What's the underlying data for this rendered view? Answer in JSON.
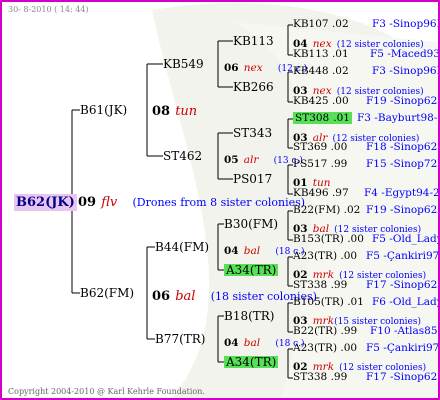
{
  "header": "30-  8-2010 ( 14: 44)",
  "footer": "Copyright 2004-2010 @ Karl Kehrle Foundation.",
  "root": {
    "name": "B62(JK)",
    "gen": "09",
    "queen": "flv",
    "note": "(Drones from 8 sister colonies)"
  },
  "l1": [
    {
      "name": "B61(JK)",
      "gen": "08",
      "queen": "tun"
    },
    {
      "name": "B62(FM)",
      "gen": "06",
      "queen": "bal",
      "note": "(18 sister colonies)"
    }
  ],
  "l2": [
    {
      "name": "KB549",
      "gen": "06",
      "queen": "nex",
      "note": "(12 c.)"
    },
    {
      "name": "ST462",
      "gen": "05",
      "queen": "alr",
      "note": "(13 c.)"
    },
    {
      "name": "B44(FM)",
      "gen": "04",
      "queen": "bal",
      "note": "(18 c.)"
    },
    {
      "name": "B77(TR)",
      "gen": "04",
      "queen": "bal",
      "note": "(18 c.)"
    }
  ],
  "l3": [
    "KB113",
    "KB266",
    "ST343",
    "PS017",
    "B30(FM)",
    "A34(TR)",
    "B18(TR)",
    "A34(TR)"
  ],
  "l4": [
    {
      "name": "KB107",
      "val": ".02",
      "ref": "F3 -Sinop96R"
    },
    {
      "gen": "04",
      "queen": "nex",
      "note": "(12 sister colonies)"
    },
    {
      "name": "KB113",
      "val": ".01",
      "ref": "F5 -Maced93R"
    },
    {
      "name": "KB448",
      "val": ".02",
      "ref": "F3 -Sinop96R"
    },
    {
      "gen": "03",
      "queen": "nex",
      "note": "(12 sister colonies)"
    },
    {
      "name": "KB425",
      "val": ".00",
      "ref": "F19 -Sinop62R"
    },
    {
      "name": "ST308",
      "val": ".01",
      "ref": "F3 -Bayburt98-3R"
    },
    {
      "gen": "03",
      "queen": "alr",
      "note": "(12 sister colonies)"
    },
    {
      "name": "ST369",
      "val": ".00",
      "ref": "F18 -Sinop62R"
    },
    {
      "name": "PS517",
      "val": ".99",
      "ref": "F15 -Sinop72R"
    },
    {
      "gen": "01",
      "queen": "tun"
    },
    {
      "name": "KB496",
      "val": ".97",
      "ref": "F4 -Egypt94-2R"
    },
    {
      "name": "B22(FM)",
      "val": ".02",
      "ref": "F19 -Sinop62R"
    },
    {
      "gen": "03",
      "queen": "bal",
      "note": "(12 sister colonies)"
    },
    {
      "name": "B153(TR)",
      "val": ".00",
      "ref": "F5 -Old_Lady"
    },
    {
      "name": "A23(TR)",
      "val": ".00",
      "ref": "F5 -Çankiri97R"
    },
    {
      "gen": "02",
      "queen": "mrk",
      "note": "(12 sister colonies)"
    },
    {
      "name": "ST338",
      "val": ".99",
      "ref": "F17 -Sinop62R"
    },
    {
      "name": "B105(TR)",
      "val": ".01",
      "ref": "F6 -Old_Lady"
    },
    {
      "gen": "03",
      "queen": "mrk",
      "note": "(15 sister colonies)"
    },
    {
      "name": "B22(TR)",
      "val": ".99",
      "ref": "F10 -Atlas85R"
    },
    {
      "name": "A23(TR)",
      "val": ".00",
      "ref": "F5 -Çankiri97R"
    },
    {
      "gen": "02",
      "queen": "mrk",
      "note": "(12 sister colonies)"
    },
    {
      "name": "ST338",
      "val": ".99",
      "ref": "F17 -Sinop62R"
    }
  ]
}
